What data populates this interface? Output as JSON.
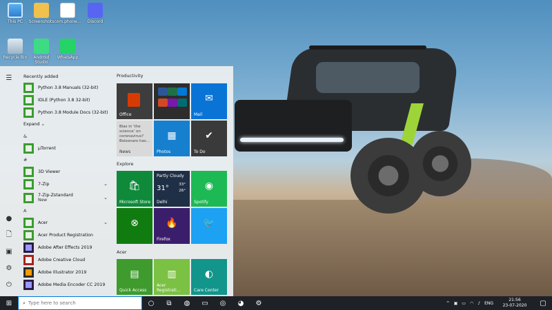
{
  "desktop": {
    "icons": [
      {
        "label": "This PC",
        "icon": "computer-icon"
      },
      {
        "label": "Screenshots",
        "icon": "folder-icon"
      },
      {
        "label": "com.phone...",
        "icon": "document-icon"
      },
      {
        "label": "Discord",
        "icon": "discord-icon"
      },
      {
        "label": "Recycle Bin",
        "icon": "recycle-bin-icon"
      },
      {
        "label": "Android Studio",
        "icon": "android-studio-icon"
      },
      {
        "label": "WhatsApp",
        "icon": "whatsapp-icon"
      }
    ]
  },
  "start_menu": {
    "recently_added": "Recently added",
    "recent": [
      {
        "label": "Python 3.8 Manuals (32-bit)"
      },
      {
        "label": "IDLE (Python 3.8 32-bit)"
      },
      {
        "label": "Python 3.8 Module Docs (32-bit)"
      }
    ],
    "expand": "Expand",
    "groups": {
      "amp": "&",
      "utorrent": "µTorrent",
      "hash": "#",
      "viewer": "3D Viewer",
      "zip": "7-Zip",
      "zstd": "7-Zip-Zstandard",
      "new": "New",
      "a": "A",
      "acer": "Acer",
      "acer_reg": "Acer Product Registration",
      "ae": "Adobe After Effects 2019",
      "cc": "Adobe Creative Cloud",
      "ai": "Adobe Illustrator 2019",
      "me": "Adobe Media Encoder CC 2019"
    }
  },
  "tiles": {
    "productivity": "Productivity",
    "explore": "Explore",
    "acer": "Acer",
    "office": "Office",
    "mail": "Mail",
    "news_text": "Bias in 'the science' on coronavirus? Bolsonaro has...",
    "news": "News",
    "photos": "Photos",
    "todo": "To Do",
    "store": "Microsoft Store",
    "weather_cond": "Partly Cloudy",
    "weather_temp": "31°",
    "weather_hi": "33°",
    "weather_lo": "26°",
    "weather_city": "Delhi",
    "spotify": "Spotify",
    "firefox": "Firefox",
    "quick_access": "Quick Access",
    "acer_reg": "Acer Registrati...",
    "care": "Care Center"
  },
  "taskbar": {
    "search_placeholder": "Type here to search",
    "lang": "ENG",
    "time": "21:56",
    "date": "23-07-2020"
  }
}
